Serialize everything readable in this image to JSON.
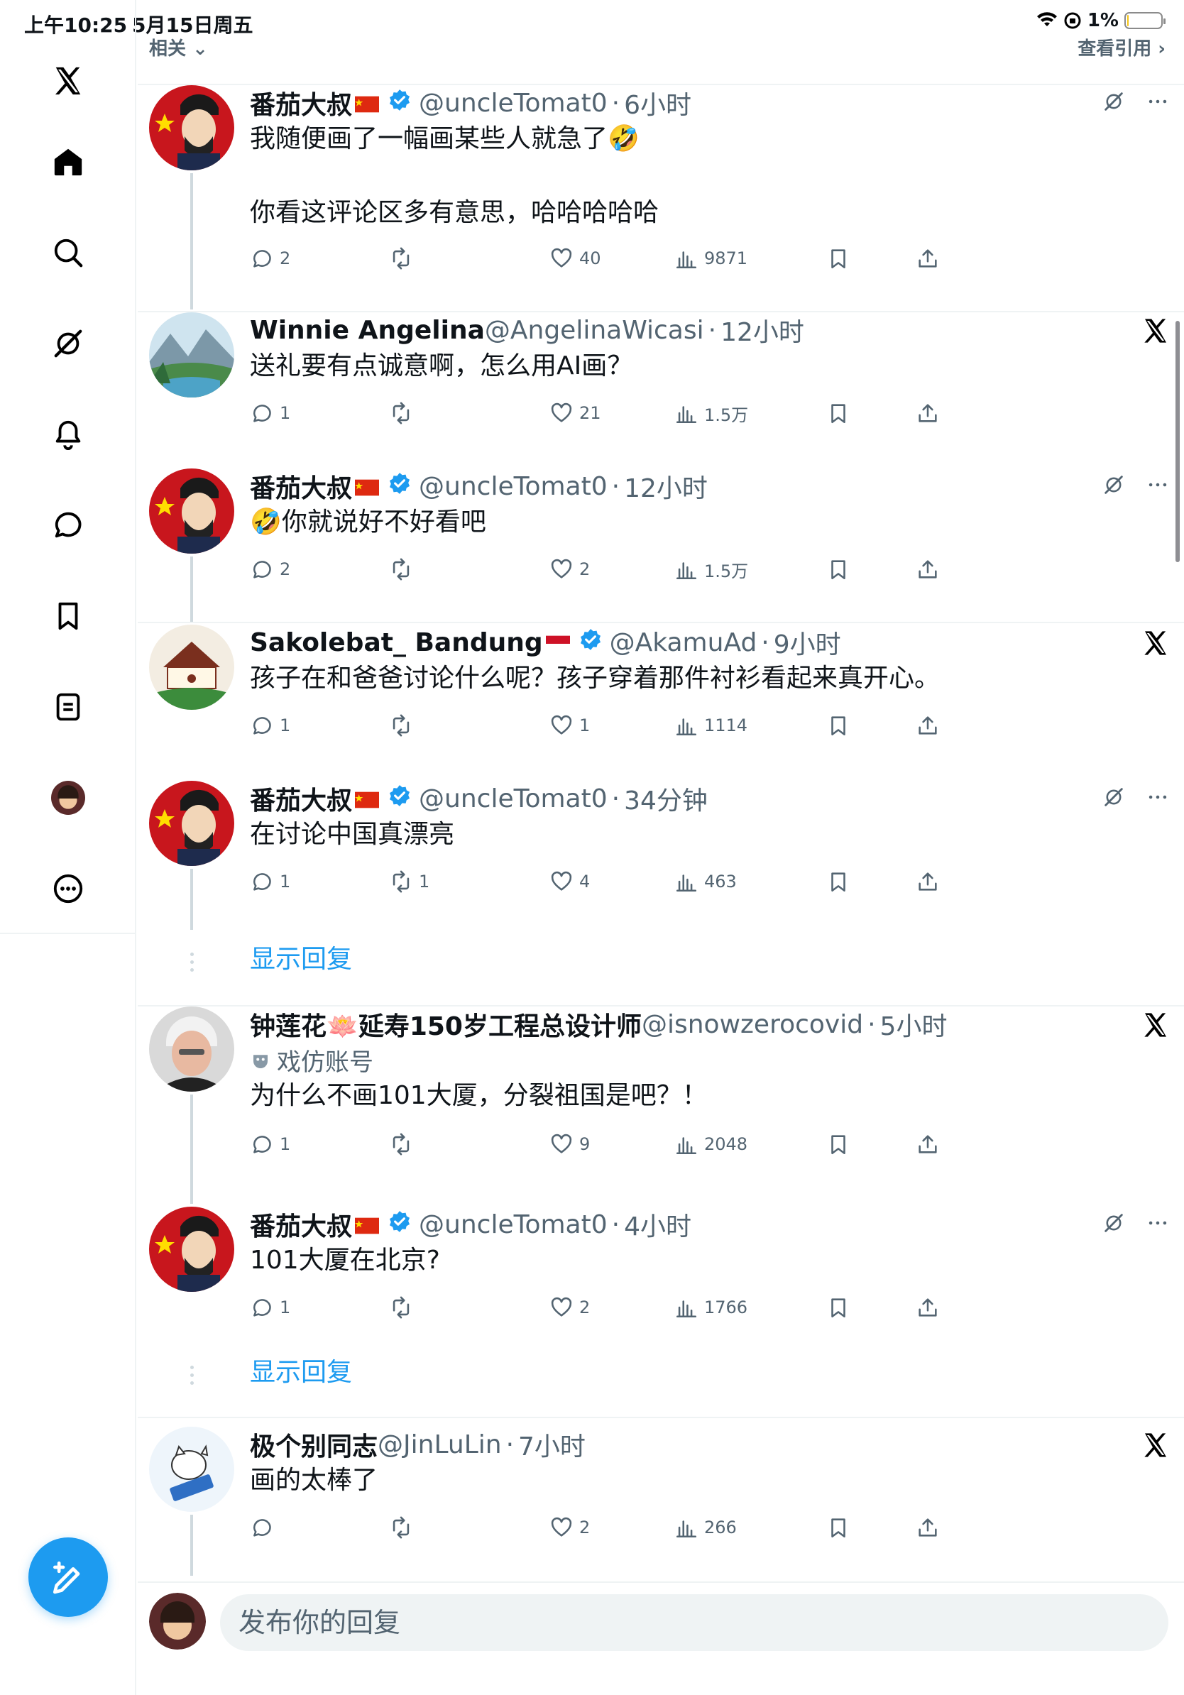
{
  "status_bar": {
    "time": "上午10:25",
    "date": "5月15日周五",
    "battery": "1%",
    "battery_level": 0.01
  },
  "topbar": {
    "related": "相关",
    "view_quotes": "查看引用"
  },
  "sidebar": {
    "items": [
      "x-logo-icon",
      "home-icon",
      "search-icon",
      "grok-icon",
      "notifications-icon",
      "messages-icon",
      "bookmarks-icon",
      "lists-icon",
      "profile-avatar",
      "more-icon"
    ],
    "compose": "compose-icon"
  },
  "colors": {
    "accent": "#1d9bf0",
    "text": "#0f1419",
    "muted": "#536471",
    "border": "#eff3f4"
  },
  "tweets": [
    {
      "name": "番茄大叔",
      "handle": "@uncleTomat0",
      "time": "6小时",
      "lines": [
        "我随便画了一幅画某些人就急了🤣",
        "",
        "你看这评论区多有意思，哈哈哈哈哈"
      ],
      "replies": "2",
      "reposts": "",
      "likes": "40",
      "views": "9871"
    },
    {
      "name": "Winnie Angelina",
      "handle": "@AngelinaWicasi",
      "time": "12小时",
      "lines": [
        "送礼要有点诚意啊，怎么用AI画？"
      ],
      "replies": "1",
      "reposts": "",
      "likes": "21",
      "views": "1.5万"
    },
    {
      "name": "番茄大叔",
      "handle": "@uncleTomat0",
      "time": "12小时",
      "lines": [
        "🤣你就说好不好看吧"
      ],
      "replies": "2",
      "reposts": "",
      "likes": "2",
      "views": "1.5万"
    },
    {
      "name": "Sakolebat_ Bandung",
      "handle": "@AkamuAd",
      "time": "9小时",
      "lines": [
        "孩子在和爸爸讨论什么呢？孩子穿着那件衬衫看起来真开心。"
      ],
      "replies": "1",
      "reposts": "",
      "likes": "1",
      "views": "1114"
    },
    {
      "name": "番茄大叔",
      "handle": "@uncleTomat0",
      "time": "34分钟",
      "lines": [
        "在讨论中国真漂亮"
      ],
      "replies": "1",
      "reposts": "1",
      "likes": "4",
      "views": "463"
    },
    {
      "name": "钟莲花🪷延寿150岁工程总设计师",
      "handle": "@isnowzerocovid",
      "time": "5小时",
      "parody": "戏仿账号",
      "lines": [
        "为什么不画101大厦，分裂祖国是吧？！"
      ],
      "replies": "1",
      "reposts": "",
      "likes": "9",
      "views": "2048"
    },
    {
      "name": "番茄大叔",
      "handle": "@uncleTomat0",
      "time": "4小时",
      "lines": [
        "101大厦在北京?"
      ],
      "replies": "1",
      "reposts": "",
      "likes": "2",
      "views": "1766"
    },
    {
      "name": "极个别同志",
      "handle": "@JinLuLin",
      "time": "7小时",
      "lines": [
        "画的太棒了"
      ],
      "replies": "",
      "reposts": "",
      "likes": "2",
      "views": "266"
    }
  ],
  "show_replies": "显示回复",
  "reply_placeholder": "发布你的回复"
}
